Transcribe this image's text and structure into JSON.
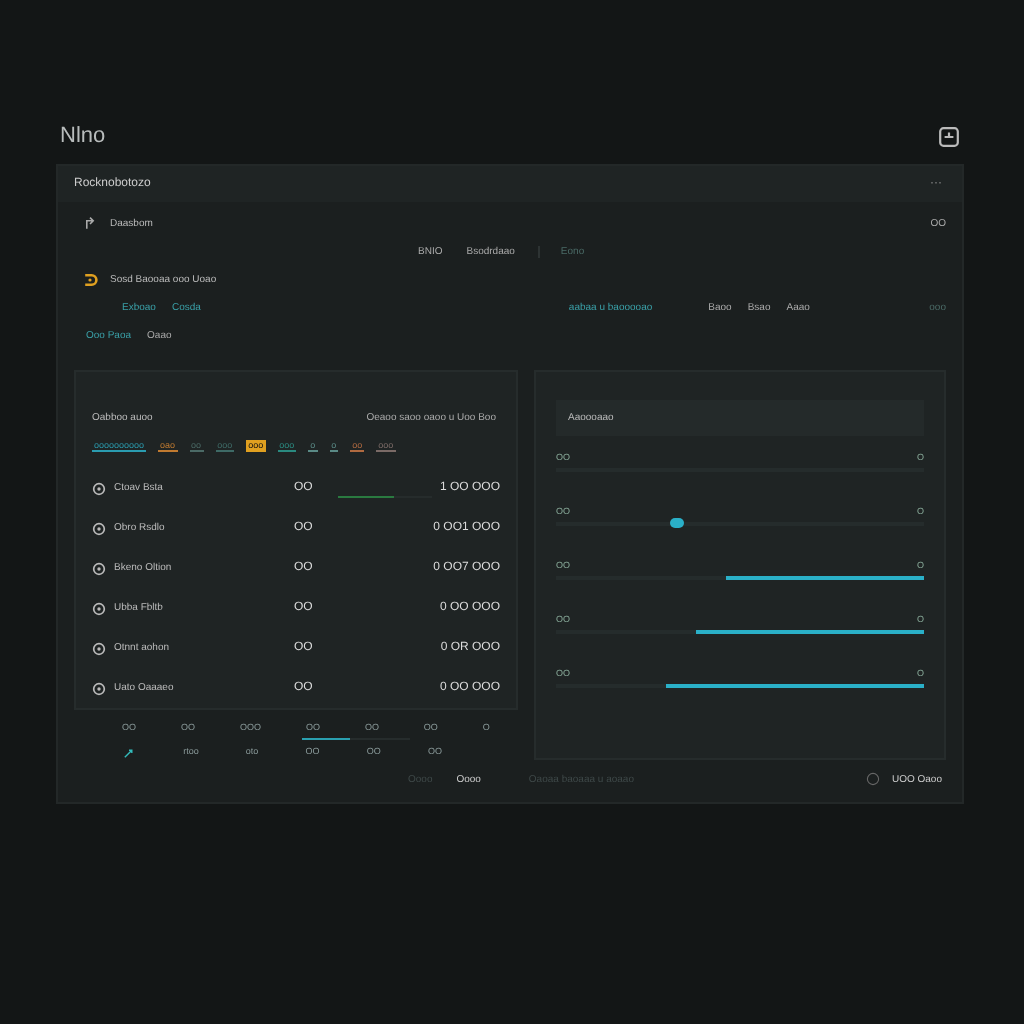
{
  "app": {
    "title": "Nlno"
  },
  "panel": {
    "title": "Rocknobotozo",
    "more": "···"
  },
  "summary": [
    {
      "kind": "nav-row",
      "label": "Daasbom",
      "value": "OO"
    },
    {
      "kind": "pair-row",
      "items": [
        "BNIO",
        "Bsodrdaao"
      ],
      "muted": "Eono"
    },
    {
      "kind": "alert-row",
      "label": "Sosd Baooaa ooo Uoao"
    },
    {
      "kind": "link-row",
      "links": [
        "Exboao",
        "Cosda"
      ],
      "link2": "aabaa u baooooao",
      "items": [
        "Baoo",
        "Bsao",
        "Aaao"
      ],
      "muted": "ooo"
    },
    {
      "kind": "link-row",
      "links": [
        "Ooo Paoa"
      ],
      "items": [
        "Oaao"
      ]
    }
  ],
  "table": {
    "title": "Oabboo auoo",
    "subtitle": "Oeaoo saoo oaoo u Uoo Boo",
    "tags": [
      {
        "label": "oooooooooo",
        "color": "#2a9cb0",
        "selected": false
      },
      {
        "label": "oao",
        "color": "#c07a30",
        "selected": false
      },
      {
        "label": "oo",
        "color": "#4b6a66",
        "selected": false
      },
      {
        "label": "ooo",
        "color": "#3e6a66",
        "selected": false
      },
      {
        "label": "ooo",
        "color": "#e0a020",
        "selected": true
      },
      {
        "label": "ooo",
        "color": "#2a8a80",
        "selected": false
      },
      {
        "label": "o",
        "color": "#5a8a86",
        "selected": false
      },
      {
        "label": "o",
        "color": "#5a8a86",
        "selected": false
      },
      {
        "label": "oo",
        "color": "#b06a40",
        "selected": false
      },
      {
        "label": "ooo",
        "color": "#7a6a66",
        "selected": false
      }
    ],
    "rows": [
      {
        "name": "Ctoav Bsta",
        "code": "OO",
        "value": "1 OO OOO",
        "level": 0.6
      },
      {
        "name": "Obro Rsdlo",
        "code": "OO",
        "value": "0 OO1 OOO"
      },
      {
        "name": "Bkeno Oltion",
        "code": "OO",
        "value": "0 OO7 OOO"
      },
      {
        "name": "Ubba Fbltb",
        "code": "OO",
        "value": "0 OO OOO"
      },
      {
        "name": "Otnnt aohon",
        "code": "OO",
        "value": "0 OR OOO"
      },
      {
        "name": "Uato Oaaaeo",
        "code": "OO",
        "value": "0 OO OOO"
      }
    ]
  },
  "axis": {
    "top": [
      "OO",
      "OO",
      "OOO",
      "OO",
      "OO",
      "OO",
      "O"
    ],
    "bottom": [
      "rtoo",
      "oto",
      "OO",
      "OO",
      "OO"
    ],
    "level": 0.45
  },
  "sliders": {
    "title": "Aaoooaao",
    "items": [
      {
        "kind": "range",
        "low": "OO",
        "high": "O",
        "level": 0
      },
      {
        "kind": "point",
        "low": "OO",
        "high": "O",
        "level": 0.33
      },
      {
        "kind": "range",
        "low": "OO",
        "high": "O",
        "level": 0.54
      },
      {
        "kind": "range",
        "low": "OO",
        "high": "O",
        "level": 0.62
      },
      {
        "kind": "range",
        "low": "OO",
        "high": "O",
        "level": 0.7
      }
    ]
  },
  "footer": {
    "buttons": [
      {
        "label": "Oooo",
        "disabled": true
      },
      {
        "label": "Oooo",
        "disabled": false
      }
    ],
    "note": "Oaoaa baoaaa u aoaao",
    "status": "UOO Oaoo"
  }
}
